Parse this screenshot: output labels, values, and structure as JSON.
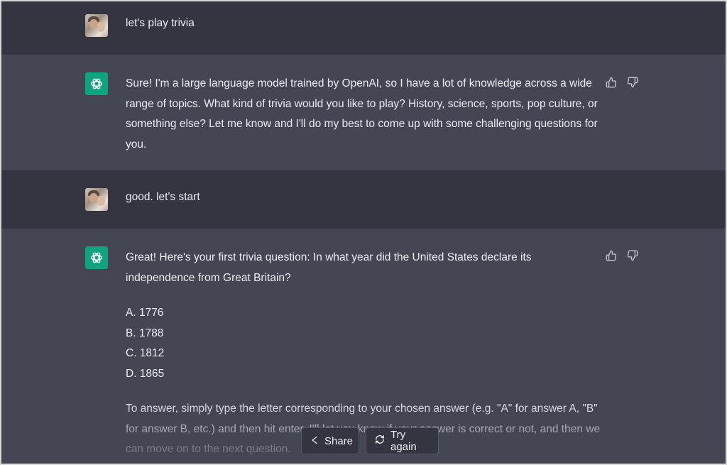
{
  "conversation": {
    "m1": {
      "role": "user",
      "text": "let's play trivia"
    },
    "m2": {
      "role": "assistant",
      "text": "Sure! I'm a large language model trained by OpenAI, so I have a lot of knowledge across a wide range of topics. What kind of trivia would you like to play? History, science, sports, pop culture, or something else? Let me know and I'll do my best to come up with some challenging questions for you."
    },
    "m3": {
      "role": "user",
      "text": "good. let's start"
    },
    "m4": {
      "role": "assistant",
      "intro": "Great! Here's your first trivia question: In what year did the United States declare its independence from Great Britain?",
      "options": [
        "A. 1776",
        "B. 1788",
        "C. 1812",
        "D. 1865"
      ],
      "outro": "To answer, simply type the letter corresponding to your chosen answer (e.g. \"A\" for answer A, \"B\" for answer B, etc.) and then hit enter. I'll let you know if your answer is correct or not, and then we can move on to the next question."
    }
  },
  "actions": {
    "share_label": "Share",
    "try_again_label": "Try again"
  },
  "icons": {
    "thumbs_up": "thumbs-up-icon",
    "thumbs_down": "thumbs-down-icon",
    "share": "share-icon",
    "regenerate": "regenerate-icon",
    "assistant_logo": "openai-logo-icon"
  },
  "colors": {
    "user_bg": "#343541",
    "assistant_bg": "#444654",
    "assistant_avatar": "#10a37f",
    "text": "#ececf1"
  }
}
